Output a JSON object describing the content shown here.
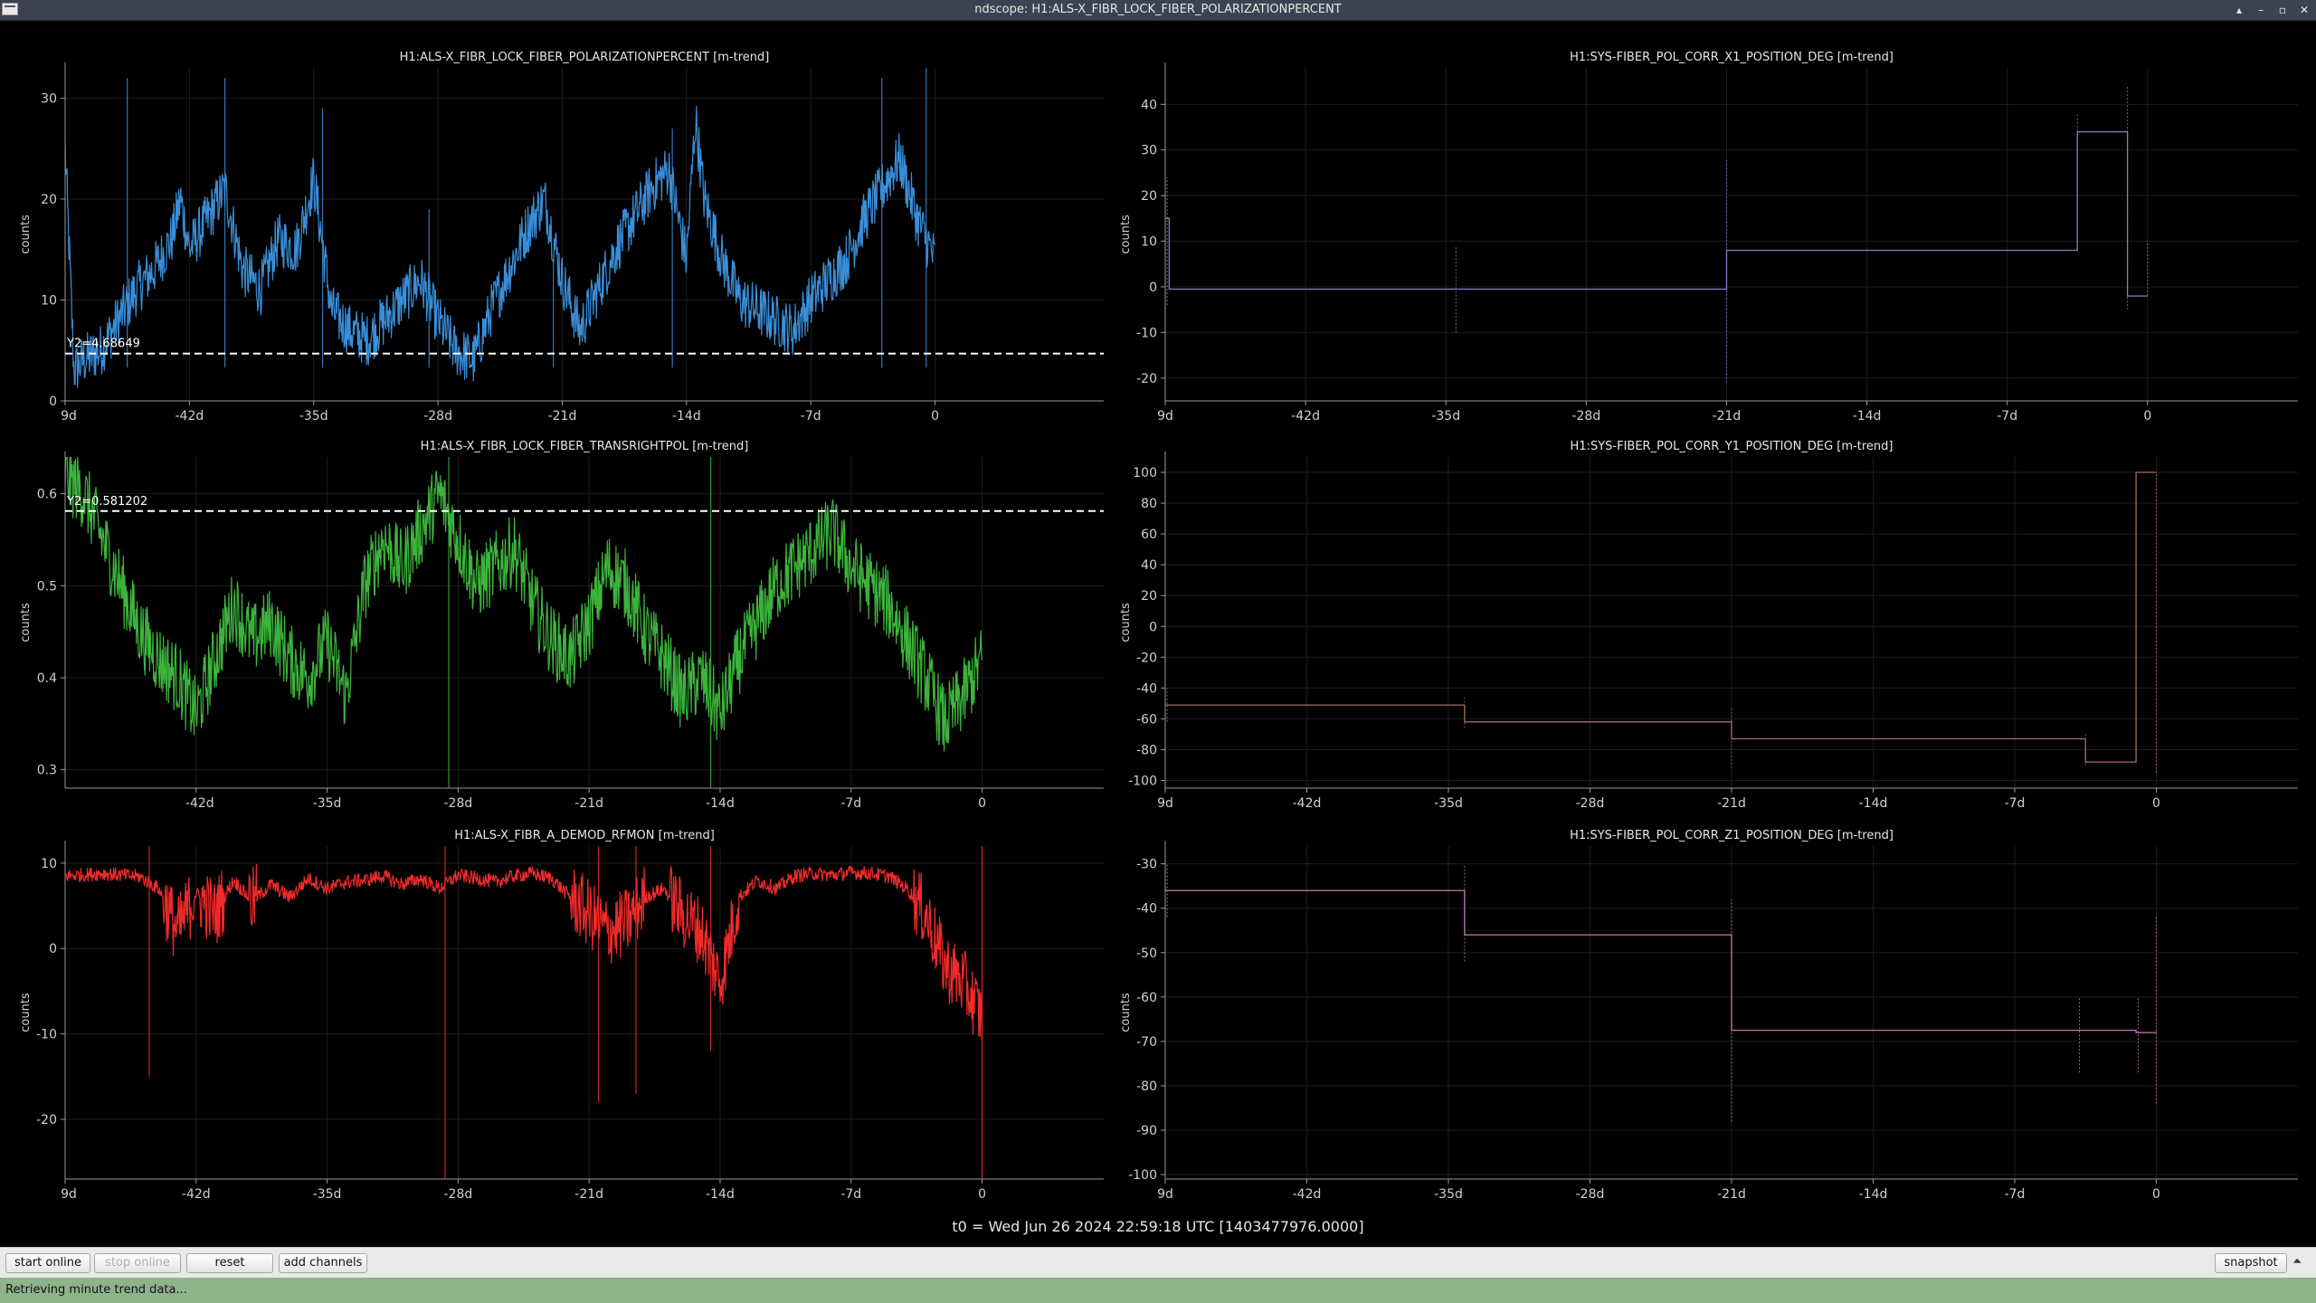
{
  "window": {
    "title": "ndscope: H1:ALS-X_FIBR_LOCK_FIBER_POLARIZATIONPERCENT",
    "controls": [
      "▴",
      "–",
      "▫",
      "✕"
    ]
  },
  "colors": {
    "blue": "#3a8ed8",
    "green": "#3cb43c",
    "red": "#ef2a2a",
    "purple": "#8f79c9",
    "brown": "#a86c5e",
    "pink": "#c77ab4",
    "grid": "#1e1e1e",
    "axis": "#9a9a9a",
    "cursor": "#ffffff"
  },
  "chart_data": [
    {
      "id": "polarization",
      "type": "line",
      "title": "H1:ALS-X_FIBR_LOCK_FIBER_POLARIZATIONPERCENT [m-trend]",
      "ylabel": "counts",
      "xlabel": "",
      "ylim": [
        0,
        33
      ],
      "yticks": [
        0,
        10,
        20,
        30
      ],
      "xlim": [
        -49,
        9.5
      ],
      "xticks": [
        -49,
        -42,
        -35,
        -28,
        -21,
        -14,
        -7,
        0
      ],
      "xtick_labels": [
        "9d",
        "-42d",
        "-35d",
        "-28d",
        "-21d",
        "-14d",
        "-7d",
        "0"
      ],
      "grid": true,
      "color_key": "blue",
      "cursor": {
        "value": 4.68649,
        "label": "Y2=4.68649"
      },
      "series": [
        {
          "x": [
            -49,
            -48.5,
            -48,
            -47,
            -46,
            -45,
            -44,
            -43,
            -42.5,
            -42,
            -41,
            -40,
            -39,
            -38,
            -37,
            -36,
            -35,
            -34,
            -33,
            -32,
            -31,
            -30,
            -29,
            -28,
            -27,
            -26,
            -25,
            -24,
            -23,
            -22,
            -21,
            -20,
            -19,
            -18,
            -17,
            -16,
            -15,
            -14,
            -13.5,
            -13,
            -12,
            -11,
            -10,
            -9,
            -8,
            -7,
            -6,
            -5,
            -4,
            -3,
            -2,
            -1,
            0
          ],
          "y": [
            25,
            3,
            4,
            5,
            8,
            11,
            13,
            16,
            20,
            15,
            18,
            21,
            13,
            11,
            16,
            15,
            22,
            9,
            7,
            6,
            8,
            10,
            12,
            8,
            5,
            4,
            9,
            13,
            17,
            20,
            12,
            7,
            11,
            15,
            18,
            21,
            23,
            14,
            28,
            20,
            14,
            10,
            9,
            8,
            7,
            10,
            12,
            14,
            18,
            21,
            24,
            18,
            14
          ]
        }
      ],
      "spikes": [
        {
          "x": -45.5,
          "ymax": 32
        },
        {
          "x": -40,
          "ymax": 32
        },
        {
          "x": -34.5,
          "ymax": 29
        },
        {
          "x": -28.5,
          "ymax": 19
        },
        {
          "x": -21.5,
          "ymax": 14
        },
        {
          "x": -14.8,
          "ymax": 27
        },
        {
          "x": -3,
          "ymax": 32
        },
        {
          "x": -0.5,
          "ymax": 33
        }
      ]
    },
    {
      "id": "x1_position",
      "type": "line",
      "title": "H1:SYS-FIBER_POL_CORR_X1_POSITION_DEG [m-trend]",
      "ylabel": "counts",
      "xlabel": "",
      "ylim": [
        -25,
        48
      ],
      "yticks": [
        -20,
        -10,
        0,
        10,
        20,
        30,
        40
      ],
      "xlim": [
        -49,
        7.5
      ],
      "xticks": [
        -49,
        -42,
        -35,
        -28,
        -21,
        -14,
        -7,
        0
      ],
      "xtick_labels": [
        "9d",
        "-42d",
        "-35d",
        "-28d",
        "-21d",
        "-14d",
        "-7d",
        "0"
      ],
      "grid": true,
      "color_key": "purple",
      "series": [
        {
          "x": [
            -49,
            -48.8,
            -48.8,
            -21,
            -21,
            -3.5,
            -3.5,
            -1,
            -1,
            0
          ],
          "y": [
            15,
            15,
            -0.5,
            -0.5,
            8,
            8,
            34,
            34,
            -2,
            -2
          ]
        }
      ],
      "spikes": [
        {
          "x": -48.9,
          "ymin": -4,
          "ymax": 24
        },
        {
          "x": -34.5,
          "ymin": -10,
          "ymax": 9
        },
        {
          "x": -21,
          "ymin": -21,
          "ymax": 28
        },
        {
          "x": -3.5,
          "ymin": 8,
          "ymax": 38
        },
        {
          "x": -1,
          "ymin": -5,
          "ymax": 44
        },
        {
          "x": 0,
          "ymin": -2,
          "ymax": 10
        }
      ]
    },
    {
      "id": "transright",
      "type": "line",
      "title": "H1:ALS-X_FIBR_LOCK_FIBER_TRANSRIGHTPOL [m-trend]",
      "ylabel": "counts",
      "xlabel": "",
      "ylim": [
        0.28,
        0.64
      ],
      "yticks": [
        0.3,
        0.4,
        0.5,
        0.6
      ],
      "xlim": [
        -49,
        6.5
      ],
      "xticks": [
        -42,
        -35,
        -28,
        -21,
        -14,
        -7,
        0
      ],
      "xtick_labels": [
        "-42d",
        "-35d",
        "-28d",
        "-21d",
        "-14d",
        "-7d",
        "0"
      ],
      "grid": true,
      "color_key": "green",
      "cursor": {
        "value": 0.581202,
        "label": "Y2=0.581202"
      },
      "series": [
        {
          "x": [
            -49,
            -48,
            -47,
            -46,
            -45,
            -44,
            -43,
            -42,
            -41,
            -40,
            -39,
            -38,
            -37,
            -36,
            -35,
            -34,
            -33,
            -32,
            -31,
            -30,
            -29,
            -28,
            -27,
            -26,
            -25,
            -24,
            -23,
            -22,
            -21,
            -20,
            -19,
            -18,
            -17,
            -16,
            -15,
            -14,
            -13,
            -12,
            -11,
            -10,
            -9,
            -8,
            -7,
            -6,
            -5,
            -4,
            -3,
            -2,
            -1,
            0
          ],
          "y": [
            0.62,
            0.6,
            0.55,
            0.5,
            0.45,
            0.42,
            0.4,
            0.36,
            0.42,
            0.48,
            0.44,
            0.46,
            0.42,
            0.4,
            0.44,
            0.38,
            0.5,
            0.55,
            0.52,
            0.56,
            0.6,
            0.55,
            0.5,
            0.52,
            0.54,
            0.48,
            0.44,
            0.42,
            0.46,
            0.52,
            0.5,
            0.45,
            0.42,
            0.38,
            0.4,
            0.36,
            0.42,
            0.46,
            0.5,
            0.52,
            0.54,
            0.56,
            0.52,
            0.5,
            0.48,
            0.44,
            0.4,
            0.35,
            0.38,
            0.42
          ]
        }
      ],
      "spikes": [
        {
          "x": -28.5,
          "ymin": 0.28
        },
        {
          "x": -14.5,
          "ymin": 0.28
        }
      ]
    },
    {
      "id": "y1_position",
      "type": "line",
      "title": "H1:SYS-FIBER_POL_CORR_Y1_POSITION_DEG [m-trend]",
      "ylabel": "counts",
      "xlabel": "",
      "ylim": [
        -105,
        110
      ],
      "yticks": [
        -100,
        -80,
        -60,
        -40,
        -20,
        0,
        20,
        40,
        60,
        80,
        100
      ],
      "xlim": [
        -49,
        7
      ],
      "xticks": [
        -49,
        -42,
        -35,
        -28,
        -21,
        -14,
        -7,
        0
      ],
      "xtick_labels": [
        "9d",
        "-42d",
        "-35d",
        "-28d",
        "-21d",
        "-14d",
        "-7d",
        "0"
      ],
      "grid": true,
      "color_key": "brown",
      "series": [
        {
          "x": [
            -49,
            -34.2,
            -34.2,
            -21,
            -21,
            -3.5,
            -3.5,
            -1,
            -1,
            0
          ],
          "y": [
            -51,
            -51,
            -62,
            -62,
            -73,
            -73,
            -88,
            -88,
            100,
            100
          ]
        }
      ],
      "spikes": [
        {
          "x": -48.9,
          "ymin": -62,
          "ymax": -40
        },
        {
          "x": -34.2,
          "ymin": -66,
          "ymax": -46
        },
        {
          "x": -21,
          "ymin": -92,
          "ymax": -52
        },
        {
          "x": -3.5,
          "ymin": -90,
          "ymax": -70
        },
        {
          "x": 0,
          "ymin": -95,
          "ymax": 100
        }
      ]
    },
    {
      "id": "demod_rfmon",
      "type": "line",
      "title": "H1:ALS-X_FIBR_A_DEMOD_RFMON [m-trend]",
      "ylabel": "counts",
      "xlabel": "",
      "ylim": [
        -27,
        12
      ],
      "yticks": [
        -20,
        -10,
        0,
        10
      ],
      "xlim": [
        -49,
        6.5
      ],
      "xticks": [
        -49,
        -42,
        -35,
        -28,
        -21,
        -14,
        -7,
        0
      ],
      "xtick_labels": [
        "9d",
        "-42d",
        "-35d",
        "-28d",
        "-21d",
        "-14d",
        "-7d",
        "0"
      ],
      "grid": true,
      "color_key": "red",
      "series": [
        {
          "x": [
            -49,
            -47,
            -45,
            -44,
            -43,
            -42,
            -41,
            -40,
            -39,
            -38,
            -37,
            -36,
            -35,
            -34,
            -33,
            -32,
            -31,
            -30,
            -29,
            -28,
            -27,
            -26,
            -25,
            -24,
            -23,
            -22,
            -21,
            -20,
            -19,
            -18,
            -17,
            -16,
            -15,
            -14,
            -13,
            -12,
            -11,
            -10,
            -9,
            -8,
            -7,
            -6,
            -5,
            -4,
            -3,
            -2,
            -1,
            0
          ],
          "y": [
            8.5,
            8.8,
            8.4,
            7,
            2,
            6.5,
            4,
            8,
            5.5,
            7.5,
            6,
            8.2,
            7,
            7.8,
            8,
            8.5,
            7.5,
            8.2,
            7,
            8.6,
            8.2,
            7.8,
            8.5,
            8.8,
            8.2,
            6,
            4,
            2,
            3,
            6,
            7,
            4,
            2,
            -4,
            6,
            8,
            7,
            8.5,
            8.8,
            8.6,
            8.9,
            8.8,
            8.5,
            7,
            4,
            -2,
            -4,
            -8
          ]
        }
      ],
      "spikes": [
        {
          "x": -28.7,
          "ymin": -27
        },
        {
          "x": -20.5,
          "ymin": -18
        },
        {
          "x": -18.5,
          "ymin": -17
        },
        {
          "x": -14.5,
          "ymin": -12
        },
        {
          "x": -44.5,
          "ymin": -15
        },
        {
          "x": 0,
          "ymin": -27
        }
      ]
    },
    {
      "id": "z1_position",
      "type": "line",
      "title": "H1:SYS-FIBER_POL_CORR_Z1_POSITION_DEG [m-trend]",
      "ylabel": "counts",
      "xlabel": "",
      "ylim": [
        -101,
        -26
      ],
      "yticks": [
        -100,
        -90,
        -80,
        -70,
        -60,
        -50,
        -40,
        -30
      ],
      "xlim": [
        -49,
        7
      ],
      "xticks": [
        -49,
        -42,
        -35,
        -28,
        -21,
        -14,
        -7,
        0
      ],
      "xtick_labels": [
        "9d",
        "-42d",
        "-35d",
        "-28d",
        "-21d",
        "-14d",
        "-7d",
        "0"
      ],
      "grid": true,
      "color_key": "pink",
      "series": [
        {
          "x": [
            -49,
            -34.2,
            -34.2,
            -21,
            -21,
            -3.8,
            -3.8,
            -1,
            -1,
            0
          ],
          "y": [
            -36,
            -36,
            -46,
            -46,
            -67.5,
            -67.5,
            -67.5,
            -67.5,
            -68,
            -68
          ]
        }
      ],
      "spikes": [
        {
          "x": -48.9,
          "ymin": -42,
          "ymax": -30
        },
        {
          "x": -34.2,
          "ymin": -52,
          "ymax": -30
        },
        {
          "x": -21,
          "ymin": -88,
          "ymax": -38
        },
        {
          "x": -3.8,
          "ymin": -77,
          "ymax": -60
        },
        {
          "x": -0.9,
          "ymin": -77,
          "ymax": -60
        },
        {
          "x": 0,
          "ymin": -84,
          "ymax": -42
        }
      ]
    }
  ],
  "footer": {
    "t0": "t0 = Wed Jun 26 2024 22:59:18 UTC [1403477976.0000]"
  },
  "toolbar": {
    "start_online": "start online",
    "stop_online": "stop online",
    "reset": "reset",
    "add_channels": "add channels",
    "snapshot": "snapshot",
    "expand_arrow": "⏶"
  },
  "status": {
    "message": "Retrieving minute trend data..."
  }
}
